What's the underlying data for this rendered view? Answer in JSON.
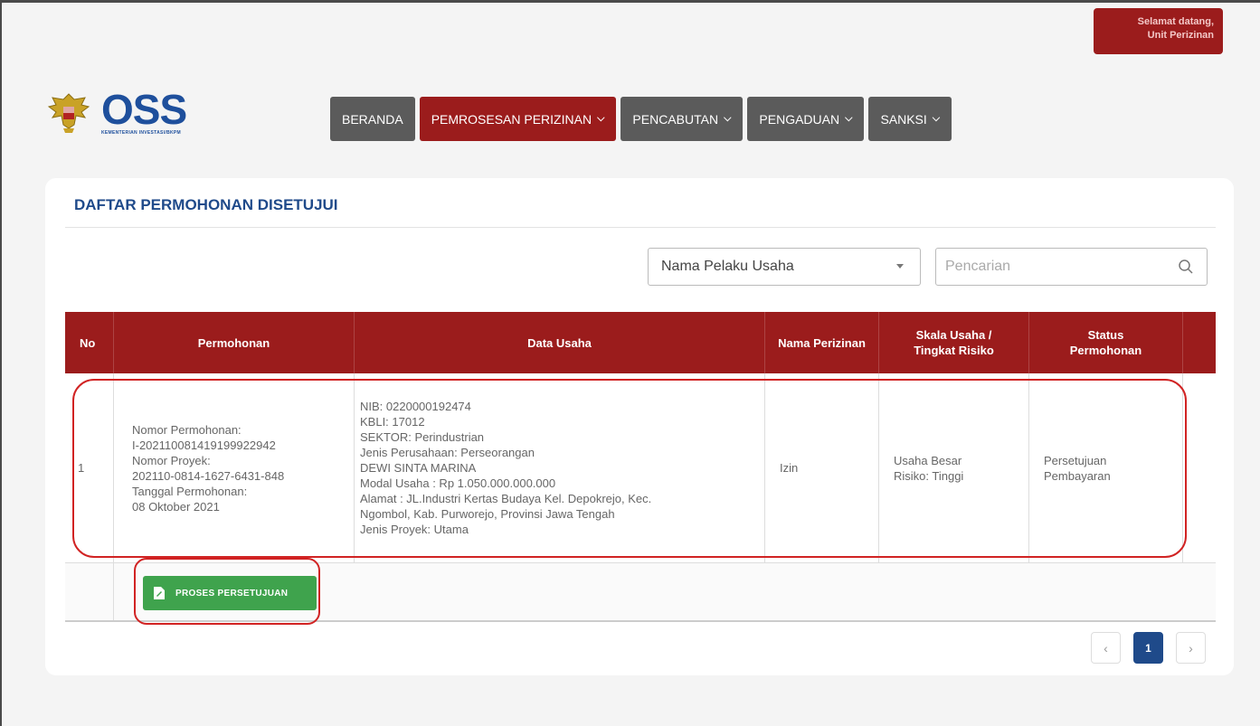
{
  "welcome": {
    "line1": "Selamat datang,",
    "line2": "Unit Perizinan"
  },
  "logo": {
    "text": "OSS",
    "tagline": "KEMENTERIAN INVESTASI/BKPM"
  },
  "nav": {
    "items": [
      {
        "label": "BERANDA",
        "active": false
      },
      {
        "label": "PEMROSESAN PERIZINAN",
        "active": true
      },
      {
        "label": "PENCABUTAN",
        "active": false
      },
      {
        "label": "PENGADUAN",
        "active": false
      },
      {
        "label": "SANKSI",
        "active": false
      }
    ]
  },
  "card": {
    "title": "DAFTAR PERMOHONAN DISETUJUI"
  },
  "filter": {
    "selected": "Nama Pelaku Usaha"
  },
  "search": {
    "placeholder": "Pencarian",
    "value": ""
  },
  "table": {
    "headers": {
      "no": "No",
      "permohonan": "Permohonan",
      "data_usaha": "Data Usaha",
      "nama_perizinan": "Nama Perizinan",
      "skala": "Skala Usaha / Tingkat Risiko",
      "status": "Status Permohonan"
    },
    "rows": [
      {
        "no": "1",
        "permohonan": [
          "Nomor Permohonan:",
          "I-202110081419199922942",
          "Nomor Proyek:",
          "202110-0814-1627-6431-848",
          "Tanggal Permohonan:",
          "08 Oktober 2021"
        ],
        "data_usaha": [
          "NIB: 0220000192474",
          "KBLI: 17012",
          "SEKTOR: Perindustrian",
          "Jenis Perusahaan: Perseorangan",
          "DEWI SINTA MARINA",
          "Modal Usaha : Rp 1.050.000.000.000",
          "Alamat : JL.Industri Kertas Budaya Kel. Depokrejo, Kec.",
          "Ngombol, Kab. Purworejo, Provinsi Jawa Tengah",
          "Jenis Proyek: Utama"
        ],
        "nama_perizinan": "Izin",
        "skala": [
          "Usaha Besar",
          "Risiko: Tinggi"
        ],
        "status": [
          "Persetujuan",
          "Pembayaran"
        ]
      }
    ]
  },
  "action": {
    "proses_label": "PROSES PERSETUJUAN"
  },
  "pagination": {
    "prev": "‹",
    "current": "1",
    "next": "›"
  },
  "colors": {
    "primary_red": "#9b1c1c",
    "nav_gray": "#5b5b5b",
    "title_blue": "#1f4a8a",
    "success_green": "#3fa34d",
    "highlight_red": "#d12323"
  }
}
